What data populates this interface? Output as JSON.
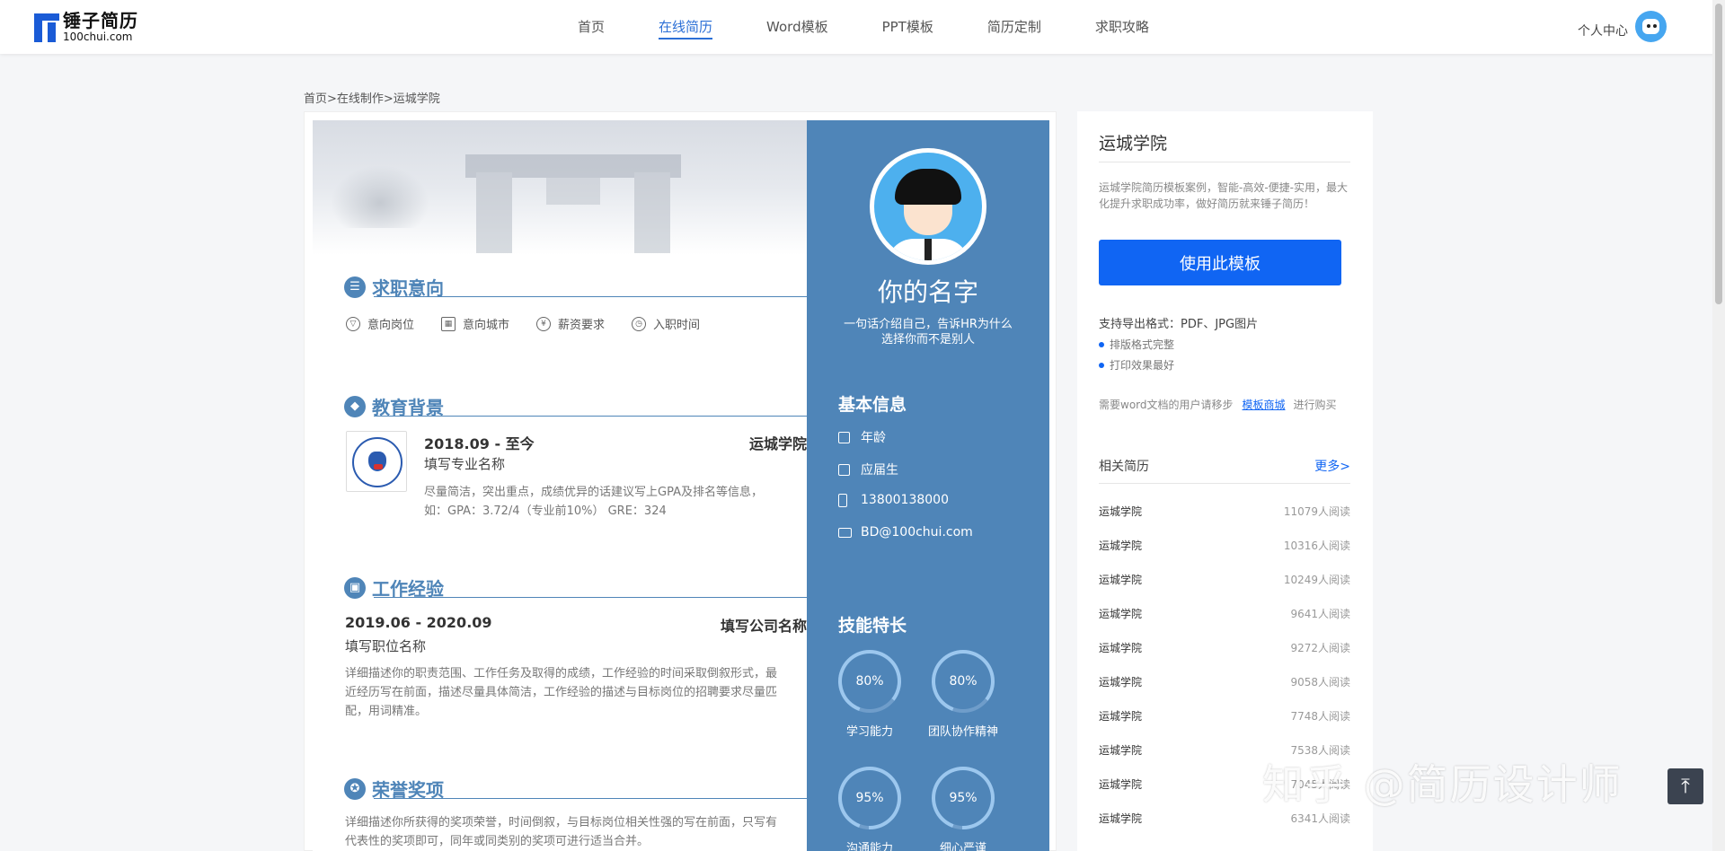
{
  "nav": {
    "logo_cn": "锤子简历",
    "logo_en": "100chui.com",
    "items": [
      {
        "label": "首页",
        "active": false
      },
      {
        "label": "在线简历",
        "active": true
      },
      {
        "label": "Word模板",
        "active": false
      },
      {
        "label": "PPT模板",
        "active": false
      },
      {
        "label": "简历定制",
        "active": false
      },
      {
        "label": "求职攻略",
        "active": false
      }
    ],
    "user_center": "个人中心"
  },
  "breadcrumb": "首页>在线制作>运城学院",
  "resume": {
    "name": "你的名字",
    "intro": "一句话介绍自己，告诉HR为什么选择你而不是别人",
    "intent": {
      "title": "求职意向",
      "items": [
        "意向岗位",
        "意向城市",
        "薪资要求",
        "入职时间"
      ]
    },
    "education": {
      "title": "教育背景",
      "date": "2018.09 - 至今",
      "school": "运城学院",
      "major": "填写专业名称",
      "desc": "尽量简洁，突出重点，成绩优异的话建议写上GPA及排名等信息，如：GPA：3.72/4（专业前10%） GRE：324"
    },
    "work": {
      "title": "工作经验",
      "date": "2019.06 - 2020.09",
      "company": "填写公司名称",
      "position": "填写职位名称",
      "desc": "详细描述你的职责范围、工作任务及取得的成绩，工作经验的时间采取倒叙形式，最近经历写在前面，描述尽量具体简洁，工作经验的描述与目标岗位的招聘要求尽量匹配，用词精准。"
    },
    "awards": {
      "title": "荣誉奖项",
      "desc": "详细描述你所获得的奖项荣誉，时间倒叙，与目标岗位相关性强的写在前面，只写有代表性的奖项即可，同年或同类别的奖项可进行适当合并。"
    },
    "basic_info": {
      "title": "基本信息",
      "age": "年龄",
      "status": "应届生",
      "phone": "13800138000",
      "email": "BD@100chui.com"
    },
    "skills": {
      "title": "技能特长",
      "items": [
        {
          "label": "学习能力",
          "percent_text": "80%",
          "value": 0.8
        },
        {
          "label": "团队协作精神",
          "percent_text": "80%",
          "value": 0.8
        },
        {
          "label": "沟通能力",
          "percent_text": "95%",
          "value": 0.95
        },
        {
          "label": "细心严谨",
          "percent_text": "95%",
          "value": 0.95
        }
      ]
    }
  },
  "sidebar": {
    "title": "运城学院",
    "desc": "运城学院简历模板案例，智能-高效-便捷-实用，最大化提升求职成功率，做好简历就来锤子简历！",
    "use_button": "使用此模板",
    "formats": "支持导出格式：PDF、JPG图片",
    "bullets": [
      "排版格式完整",
      "打印效果最好"
    ],
    "buy_prefix": "需要word文档的用户请移步",
    "buy_link": "模板商城",
    "buy_suffix": "进行购买",
    "related_title": "相关简历",
    "related_more": "更多>",
    "related": [
      {
        "name": "运城学院",
        "count": "11079人阅读"
      },
      {
        "name": "运城学院",
        "count": "10316人阅读"
      },
      {
        "name": "运城学院",
        "count": "10249人阅读"
      },
      {
        "name": "运城学院",
        "count": "9641人阅读"
      },
      {
        "name": "运城学院",
        "count": "9272人阅读"
      },
      {
        "name": "运城学院",
        "count": "9058人阅读"
      },
      {
        "name": "运城学院",
        "count": "7748人阅读"
      },
      {
        "name": "运城学院",
        "count": "7538人阅读"
      },
      {
        "name": "运城学院",
        "count": "7045人阅读"
      },
      {
        "name": "运城学院",
        "count": "6341人阅读"
      }
    ]
  },
  "watermark": "知乎 @简历设计师",
  "colors": {
    "accent": "#4f85b8",
    "primary_button": "#1065f3",
    "nav_active": "#2b6fd6"
  }
}
